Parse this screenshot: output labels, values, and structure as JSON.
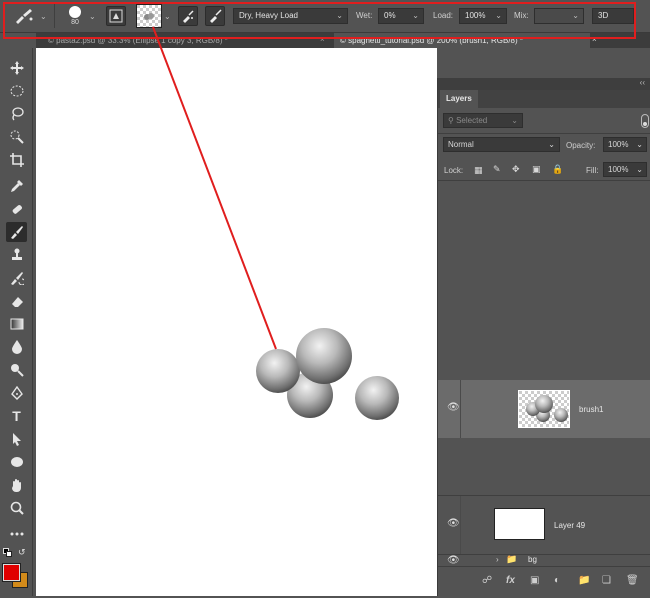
{
  "options_bar": {
    "brush_size": "80",
    "mixer_preset": "Dry, Heavy Load",
    "wet_label": "Wet:",
    "wet_value": "0%",
    "load_label": "Load:",
    "load_value": "100%",
    "mix_label": "Mix:",
    "mode_3d": "3D"
  },
  "tabs": [
    {
      "label": "© pasta2.psd @ 33.3% (Ellipse 1 copy 3, RGB/8) *"
    },
    {
      "label": "© spaghetti_tutorial.psd @ 200% (brush1, RGB/8) *"
    }
  ],
  "layers_panel": {
    "tab_label": "Layers",
    "filter_placeholder": "Selected",
    "blend_mode": "Normal",
    "opacity_label": "Opacity:",
    "opacity_value": "100%",
    "lock_label": "Lock:",
    "fill_label": "Fill:",
    "fill_value": "100%",
    "layers": [
      {
        "name": "brush1"
      },
      {
        "name": "Layer 49"
      },
      {
        "name": "bg"
      }
    ],
    "footer_fx": "fx"
  },
  "colors": {
    "foreground": "#e00000",
    "background": "#d28a1a",
    "highlight": "#e01e1e"
  }
}
